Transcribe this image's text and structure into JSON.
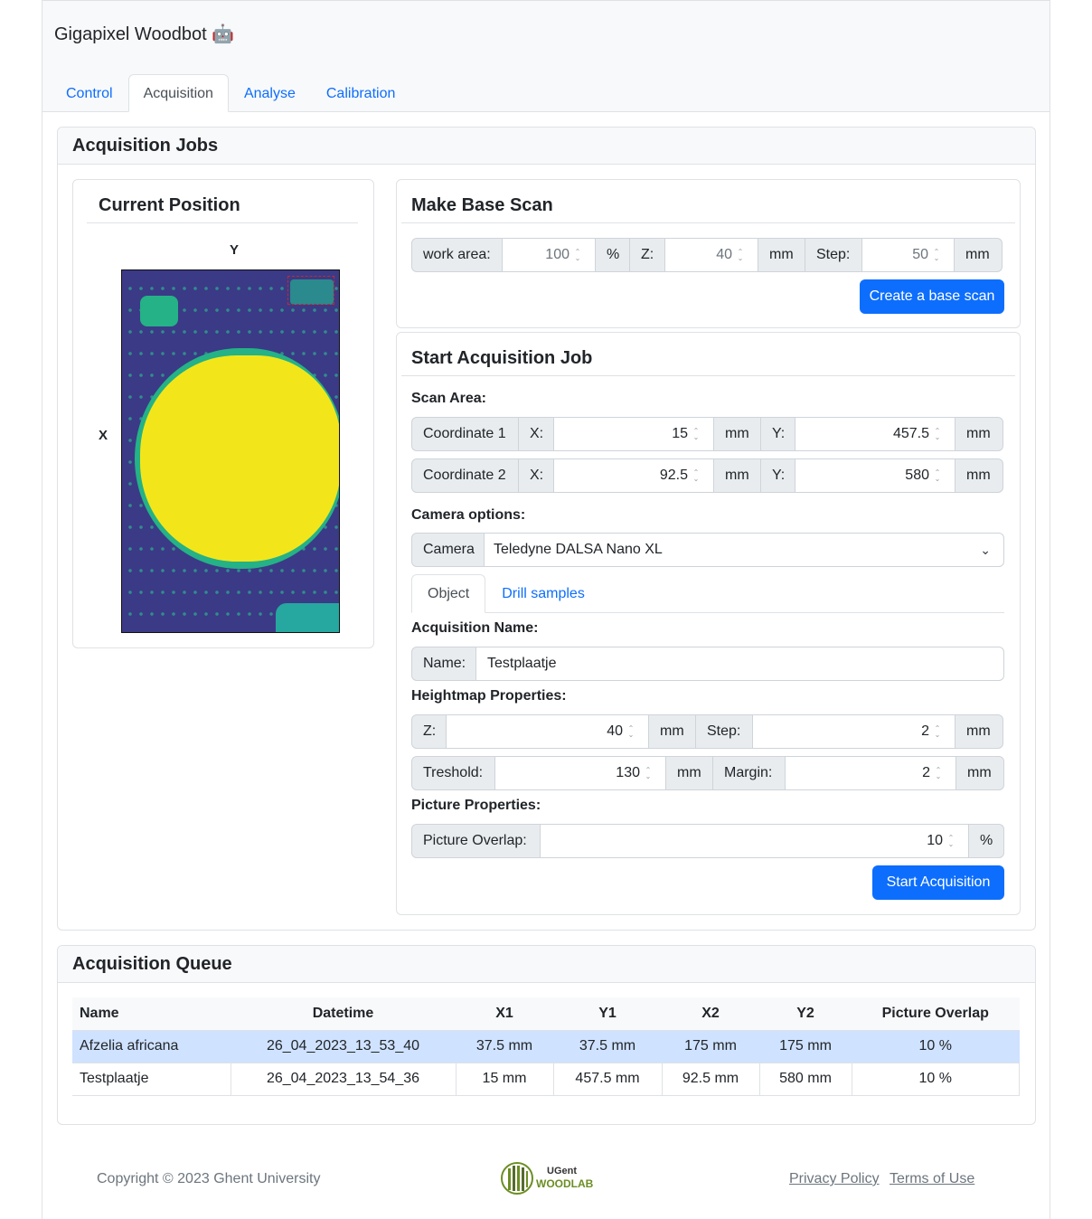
{
  "app": {
    "title": "Gigapixel Woodbot 🤖"
  },
  "nav": {
    "tabs": [
      "Control",
      "Acquisition",
      "Analyse",
      "Calibration"
    ],
    "active": "Acquisition"
  },
  "jobs": {
    "title": "Acquisition Jobs",
    "position": {
      "title": "Current Position",
      "axis_y": "Y",
      "axis_x": "X"
    },
    "base_scan": {
      "title": "Make Base Scan",
      "work_area_label": "work area:",
      "work_area_value": "100",
      "work_area_unit": "%",
      "z_label": "Z:",
      "z_value": "40",
      "z_unit": "mm",
      "step_label": "Step:",
      "step_value": "50",
      "step_unit": "mm",
      "button": "Create a base scan"
    },
    "start_job": {
      "title": "Start Acquisition Job",
      "scan_area_label": "Scan Area:",
      "coord1": {
        "label": "Coordinate 1",
        "x_label": "X:",
        "x_value": "15",
        "x_unit": "mm",
        "y_label": "Y:",
        "y_value": "457.5",
        "y_unit": "mm"
      },
      "coord2": {
        "label": "Coordinate 2",
        "x_label": "X:",
        "x_value": "92.5",
        "x_unit": "mm",
        "y_label": "Y:",
        "y_value": "580",
        "y_unit": "mm"
      },
      "camera_options_label": "Camera options:",
      "camera_label": "Camera",
      "camera_value": "Teledyne DALSA Nano XL",
      "tabs": [
        "Object",
        "Drill samples"
      ],
      "acq_name_label": "Acquisition Name:",
      "name_label": "Name:",
      "name_value": "Testplaatje",
      "heightmap_label": "Heightmap Properties:",
      "hm_z_label": "Z:",
      "hm_z_value": "40",
      "hm_z_unit": "mm",
      "hm_step_label": "Step:",
      "hm_step_value": "2",
      "hm_step_unit": "mm",
      "threshold_label": "Treshold:",
      "threshold_value": "130",
      "threshold_unit": "mm",
      "margin_label": "Margin:",
      "margin_value": "2",
      "margin_unit": "mm",
      "picture_props_label": "Picture Properties:",
      "overlap_label": "Picture Overlap:",
      "overlap_value": "10",
      "overlap_unit": "%",
      "button": "Start Acquisition"
    }
  },
  "queue": {
    "title": "Acquisition Queue",
    "columns": [
      "Name",
      "Datetime",
      "X1",
      "Y1",
      "X2",
      "Y2",
      "Picture Overlap"
    ],
    "rows": [
      [
        "Afzelia africana",
        "26_04_2023_13_53_40",
        "37.5 mm",
        "37.5 mm",
        "175 mm",
        "175 mm",
        "10 %"
      ],
      [
        "Testplaatje",
        "26_04_2023_13_54_36",
        "15 mm",
        "457.5 mm",
        "92.5 mm",
        "580 mm",
        "10 %"
      ]
    ]
  },
  "footer": {
    "copyright": "Copyright © 2023 Ghent University",
    "logo_top": "UGent",
    "logo_bottom": "WOODLAB",
    "links": [
      "Privacy Policy",
      "Terms of Use"
    ]
  },
  "colors": {
    "primary": "#0d6efd",
    "selected_row": "#cfe2ff",
    "map_bg": "#3b3a86",
    "map_blob": "#f2e61a"
  }
}
